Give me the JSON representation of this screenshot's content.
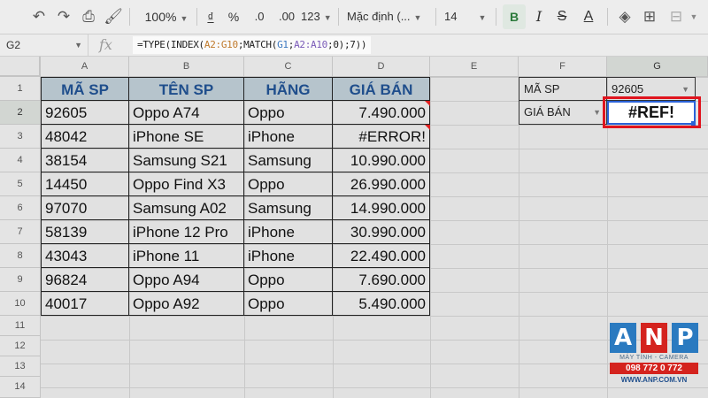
{
  "toolbar": {
    "undo_icon": "undo-icon",
    "redo_icon": "redo-icon",
    "zoom": "100%",
    "currency": "₫",
    "percent": "%",
    "dec_less": ".0",
    "dec_more": ".00",
    "format_more": "123",
    "font": "Mặc định (...",
    "font_size": "14",
    "bold": "B",
    "italic": "I",
    "strike": "S",
    "text_color": "A"
  },
  "formula_bar": {
    "name_box": "G2",
    "fx": "fx",
    "formula": {
      "p1": "=TYPE(INDEX(",
      "ref1": "A2:G10",
      "p2": ";MATCH(",
      "ref2": "G1",
      "p3": ";",
      "ref3": "A2:A10",
      "p4": ";0);7))"
    }
  },
  "columns": [
    "A",
    "B",
    "C",
    "D",
    "E",
    "F",
    "G"
  ],
  "rows": [
    "1",
    "2",
    "3",
    "4",
    "5",
    "6",
    "7",
    "8",
    "9",
    "10",
    "11",
    "12",
    "13",
    "14"
  ],
  "table": {
    "headers": [
      "MÃ SP",
      "TÊN SP",
      "HÃNG",
      "GIÁ BÁN"
    ],
    "rows": [
      [
        "92605",
        "Oppo A74",
        "Oppo",
        "7.490.000"
      ],
      [
        "48042",
        "iPhone SE",
        "iPhone",
        "#ERROR!"
      ],
      [
        "38154",
        "Samsung S21",
        "Samsung",
        "10.990.000"
      ],
      [
        "14450",
        "Oppo Find X3",
        "Oppo",
        "26.990.000"
      ],
      [
        "97070",
        "Samsung A02",
        "Samsung",
        "14.990.000"
      ],
      [
        "58139",
        "iPhone 12 Pro",
        "iPhone",
        "30.990.000"
      ],
      [
        "43043",
        "iPhone 11",
        "iPhone",
        "22.490.000"
      ],
      [
        "96824",
        "Oppo A94",
        "Oppo",
        "7.690.000"
      ],
      [
        "40017",
        "Oppo A92",
        "Oppo",
        "5.490.000"
      ]
    ]
  },
  "lookup": {
    "f1": "MÃ SP",
    "g1": "92605",
    "f2": "GIÁ BÁN",
    "g2": "#REF!"
  },
  "logo": {
    "letters": [
      "A",
      "N",
      "P"
    ],
    "tagline": "MÁY TÍNH - CAMERA",
    "phone": "098 772 0 772",
    "url": "WWW.ANP.COM.VN"
  },
  "colors": {
    "header_fill": "#b6c4cc",
    "header_text": "#1f4e8c",
    "selection": "#2a62d8",
    "highlight": "#e0141e"
  }
}
